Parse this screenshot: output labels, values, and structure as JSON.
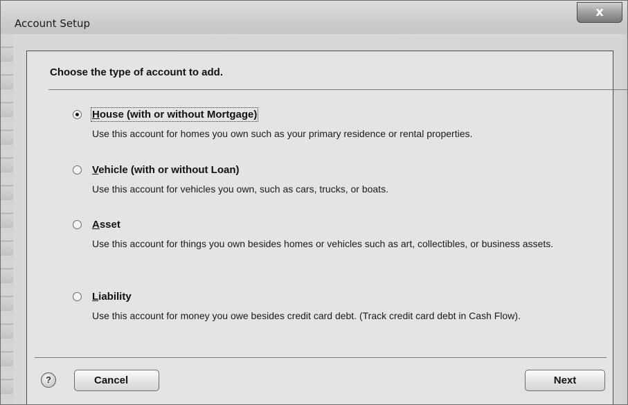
{
  "window": {
    "title": "Account Setup",
    "close_label": "x"
  },
  "heading": "Choose the type of account to add.",
  "options": [
    {
      "mnemonic": "H",
      "label_rest": "ouse (with or without Mortgage)",
      "description": "Use this account for homes you own such as your primary residence or rental properties.",
      "selected": true
    },
    {
      "mnemonic": "V",
      "label_rest": "ehicle (with or without Loan)",
      "description": "Use this account for vehicles you own, such as cars, trucks, or boats.",
      "selected": false
    },
    {
      "mnemonic": "A",
      "label_rest": "sset",
      "description": "Use this account for things you own besides homes or vehicles such as art, collectibles, or business assets.",
      "selected": false
    },
    {
      "mnemonic": "L",
      "label_rest": "iability",
      "description": "Use this account for money you owe besides credit card debt. (Track credit card debt in Cash Flow).",
      "selected": false
    }
  ],
  "footer": {
    "help_glyph": "?",
    "cancel_label": "Cancel",
    "next_label": "Next"
  }
}
